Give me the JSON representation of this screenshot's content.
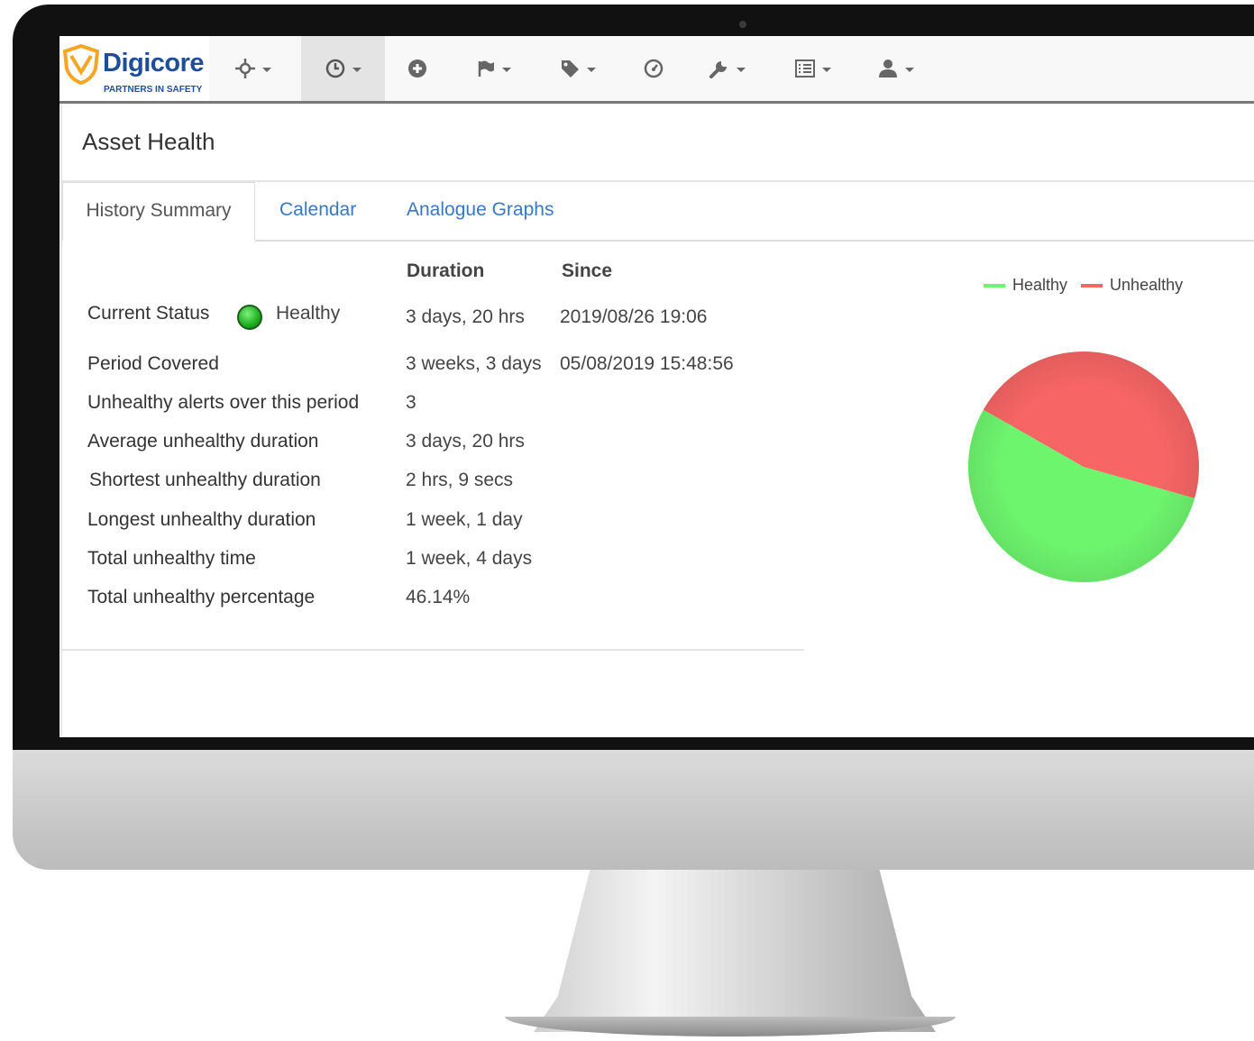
{
  "brand": {
    "name": "Digicore",
    "tagline": "PARTNERS IN SAFETY",
    "colors": {
      "primary": "#1f4e98",
      "accent": "#f5a623"
    }
  },
  "nav": {
    "items": [
      {
        "icon": "crosshair-icon",
        "has_caret": true,
        "active": false
      },
      {
        "icon": "clock-icon",
        "has_caret": true,
        "active": true
      },
      {
        "icon": "plus-circle-icon",
        "has_caret": false,
        "active": false
      },
      {
        "icon": "flag-icon",
        "has_caret": true,
        "active": false
      },
      {
        "icon": "tag-icon",
        "has_caret": true,
        "active": false
      },
      {
        "icon": "dashboard-icon",
        "has_caret": false,
        "active": false
      },
      {
        "icon": "wrench-icon",
        "has_caret": true,
        "active": false
      },
      {
        "icon": "list-icon",
        "has_caret": true,
        "active": false
      },
      {
        "icon": "user-icon",
        "has_caret": true,
        "active": false
      }
    ]
  },
  "panel": {
    "title": "Asset Health",
    "tabs": [
      "History Summary",
      "Calendar",
      "Analogue Graphs"
    ],
    "active_tab": 0
  },
  "summary": {
    "headers": {
      "duration": "Duration",
      "since": "Since"
    },
    "current_status": {
      "label": "Current Status",
      "status": "Healthy",
      "duration": "3 days, 20 hrs",
      "since": "2019/08/26 19:06"
    },
    "period": {
      "label": "Period Covered",
      "duration": "3 weeks, 3 days",
      "since": "05/08/2019 15:48:56"
    },
    "rows": [
      {
        "label": "Unhealthy alerts over this period",
        "value": "3"
      },
      {
        "label": "Average unhealthy duration",
        "value": "3 days, 20 hrs"
      },
      {
        "label": "Shortest unhealthy duration",
        "value": "2 hrs, 9 secs"
      },
      {
        "label": "Longest unhealthy duration",
        "value": "1 week, 1 day"
      },
      {
        "label": "Total unhealthy time",
        "value": "1 week, 4 days"
      },
      {
        "label": "Total unhealthy percentage",
        "value": "46.14%"
      }
    ]
  },
  "chart_data": {
    "type": "pie",
    "series": [
      {
        "name": "Healthy",
        "value": 53.86,
        "color": "#6ef56e"
      },
      {
        "name": "Unhealthy",
        "value": 46.14,
        "color": "#f76565"
      }
    ],
    "legend_placement": "top"
  }
}
